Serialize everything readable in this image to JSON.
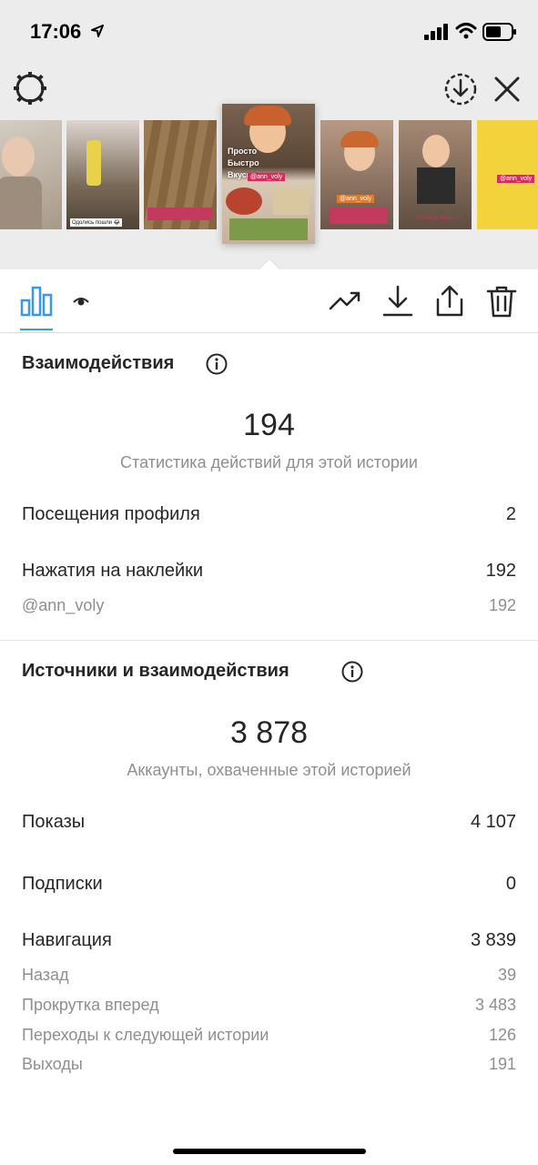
{
  "status_bar": {
    "time": "17:06"
  },
  "thumbnails": [
    {
      "id": "thumb-1",
      "bg": "#b8b0a6",
      "tags": []
    },
    {
      "id": "thumb-2",
      "bg": "#6d5f4e",
      "caption": "Одолись пошли 😂"
    },
    {
      "id": "thumb-3",
      "bg": "#8a6a45",
      "caption": ""
    },
    {
      "id": "thumb-4",
      "bg": "#5b4a3c",
      "overlay": [
        "Просто",
        "Быстро",
        "Вкусно"
      ],
      "tag": "@ann_voly"
    },
    {
      "id": "thumb-5",
      "bg": "#9a7f6d",
      "tag": "@ann_voly"
    },
    {
      "id": "thumb-6",
      "bg": "#7d6a5e",
      "caption": "Хочется много-то"
    },
    {
      "id": "thumb-7",
      "bg": "#f2d33b",
      "tag": "@ann_voly"
    }
  ],
  "interactions": {
    "title": "Взаимодействия",
    "total": "194",
    "caption": "Статистика действий для этой истории",
    "profile_visits_label": "Посещения профиля",
    "profile_visits_value": "2",
    "sticker_taps_label": "Нажатия на наклейки",
    "sticker_taps_value": "192",
    "sticker_handle_label": "@ann_voly",
    "sticker_handle_value": "192"
  },
  "discovery": {
    "title": "Источники и взаимодействия",
    "total": "3 878",
    "caption": "Аккаунты, охваченные этой историей",
    "impressions_label": "Показы",
    "impressions_value": "4 107",
    "follows_label": "Подписки",
    "follows_value": "0",
    "navigation_label": "Навигация",
    "navigation_value": "3 839",
    "back_label": "Назад",
    "back_value": "39",
    "forward_label": "Прокрутка вперед",
    "forward_value": "3 483",
    "next_story_label": "Переходы к следующей истории",
    "next_story_value": "126",
    "exits_label": "Выходы",
    "exits_value": "191"
  },
  "icons": {
    "settings": "gear-icon",
    "download": "download-circle-icon",
    "close": "close-icon",
    "insights": "bar-chart-icon",
    "viewers": "eye-icon",
    "promote": "trend-up-icon",
    "save": "download-icon",
    "share": "share-icon",
    "delete": "trash-icon"
  },
  "colors": {
    "accent": "#3897f0",
    "tag": "#d1305f",
    "muted": "#8e8e8e"
  }
}
